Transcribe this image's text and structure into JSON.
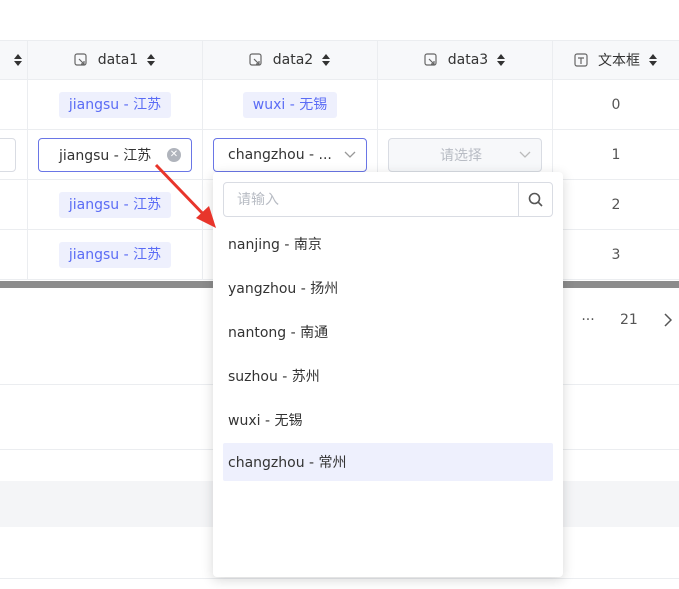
{
  "columns": {
    "data1": {
      "label": "data1",
      "icon": "select-field-icon"
    },
    "data2": {
      "label": "data2",
      "icon": "select-field-icon"
    },
    "data3": {
      "label": "data3",
      "icon": "select-field-icon"
    },
    "text": {
      "label": "文本框",
      "icon": "textbox-icon"
    }
  },
  "rows": [
    {
      "data1": "jiangsu - 江苏",
      "data2": "wuxi - 无锡",
      "data3": "",
      "text": "0"
    },
    {
      "data1": "jiangsu - 江苏",
      "data2": "changzhou - ...",
      "data3": "请选择",
      "text": "1"
    },
    {
      "data1": "jiangsu - 江苏",
      "data2": "",
      "data3": "",
      "text": "2"
    },
    {
      "data1": "jiangsu - 江苏",
      "data2": "",
      "data3": "",
      "text": "3"
    }
  ],
  "pagination": {
    "ellipsis": "···",
    "last_page": "21"
  },
  "dropdown": {
    "search_placeholder": "请输入",
    "options": [
      {
        "label": "nanjing - 南京"
      },
      {
        "label": "yangzhou - 扬州"
      },
      {
        "label": "nantong - 南通"
      },
      {
        "label": "suzhou - 苏州"
      },
      {
        "label": "wuxi - 无锡"
      },
      {
        "label": "changzhou - 常州"
      }
    ],
    "selected": "changzhou - 常州"
  },
  "colors": {
    "accent": "#5b6cf5",
    "tag_bg": "#eef0fd",
    "arrow": "#e8352b"
  }
}
